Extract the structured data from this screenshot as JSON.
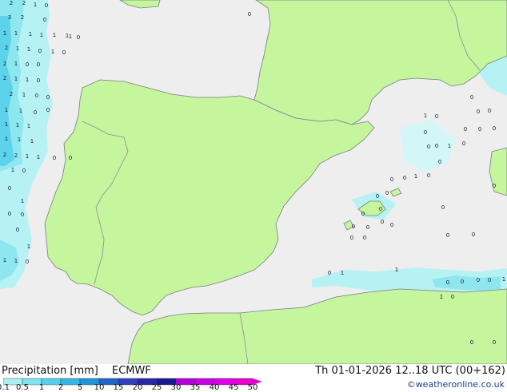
{
  "map": {
    "colors": {
      "land": "#c5f59c",
      "sea": "#eeeeee",
      "border": "#8c9095",
      "coast": "#7a7f84"
    },
    "precip_labels": [
      {
        "t": "2",
        "c": "#1a1a3a"
      },
      {
        "t": "2",
        "c": "#1a1a3a"
      },
      {
        "t": "1",
        "c": "#1a1a3a"
      },
      {
        "t": "0",
        "c": "#1a1a3a"
      },
      {
        "t": "3",
        "c": "#1a1a3a"
      },
      {
        "t": "2",
        "c": "#1a1a3a"
      },
      {
        "t": "0",
        "c": "#1a1a3a"
      },
      {
        "t": "1",
        "c": "#1a1a3a"
      },
      {
        "t": "1",
        "c": "#1a1a3a"
      },
      {
        "t": "1",
        "c": "#1a1a3a"
      },
      {
        "t": "1",
        "c": "#1a1a3a"
      },
      {
        "t": "1",
        "c": "#1a1a3a"
      },
      {
        "t": "1",
        "c": "#1a1a3a"
      },
      {
        "t": "0",
        "c": "#1a1a3a"
      },
      {
        "t": "2",
        "c": "#1a1a3a"
      },
      {
        "t": "1",
        "c": "#1a1a3a"
      },
      {
        "t": "1",
        "c": "#1a1a3a"
      },
      {
        "t": "0",
        "c": "#1a1a3a"
      },
      {
        "t": "1",
        "c": "#1a1a3a"
      },
      {
        "t": "0",
        "c": "#1a1a3a"
      },
      {
        "t": "2",
        "c": "#1a1a3a"
      },
      {
        "t": "1",
        "c": "#1a1a3a"
      },
      {
        "t": "0",
        "c": "#1a1a3a"
      },
      {
        "t": "0",
        "c": "#1a1a3a"
      },
      {
        "t": "2",
        "c": "#1a1a3a"
      },
      {
        "t": "1",
        "c": "#1a1a3a"
      },
      {
        "t": "1",
        "c": "#1a1a3a"
      },
      {
        "t": "0",
        "c": "#1a1a3a"
      },
      {
        "t": "2",
        "c": "#1a1a3a"
      },
      {
        "t": "1",
        "c": "#1a1a3a"
      },
      {
        "t": "0",
        "c": "#1a1a3a"
      },
      {
        "t": "0",
        "c": "#1a1a3a"
      },
      {
        "t": "1",
        "c": "#1a1a3a"
      },
      {
        "t": "1",
        "c": "#1a1a3a"
      },
      {
        "t": "0",
        "c": "#1a1a3a"
      },
      {
        "t": "1",
        "c": "#1a1a3a"
      },
      {
        "t": "1",
        "c": "#1a1a3a"
      },
      {
        "t": "1",
        "c": "#1a1a3a"
      },
      {
        "t": "1",
        "c": "#1a1a3a"
      },
      {
        "t": "1",
        "c": "#1a1a3a"
      },
      {
        "t": "1",
        "c": "#1a1a3a"
      },
      {
        "t": "2",
        "c": "#1a1a3a"
      },
      {
        "t": "2",
        "c": "#1a1a3a"
      },
      {
        "t": "1",
        "c": "#1a1a3a"
      },
      {
        "t": "1",
        "c": "#1a1a3a"
      },
      {
        "t": "0",
        "c": "#1a1a3a"
      },
      {
        "t": "1",
        "c": "#1a1a3a"
      },
      {
        "t": "0",
        "c": "#1a1a3a"
      },
      {
        "t": "0",
        "c": "#1a1a3a"
      },
      {
        "t": "1",
        "c": "#1a1a3a"
      },
      {
        "t": "0",
        "c": "#1a1a3a"
      },
      {
        "t": "0",
        "c": "#1a1a3a"
      },
      {
        "t": "0",
        "c": "#1a1a3a"
      },
      {
        "t": "1",
        "c": "#1a1a3a"
      },
      {
        "t": "1",
        "c": "#1a1a3a"
      },
      {
        "t": "1",
        "c": "#1a1a3a"
      },
      {
        "t": "0",
        "c": "#1a1a3a"
      },
      {
        "t": "1",
        "c": "#1a1a3a"
      },
      {
        "t": "0",
        "c": "#1a1a3a"
      },
      {
        "t": "0",
        "c": "#1a1a3a"
      },
      {
        "t": "0",
        "c": "#1a1a3a"
      },
      {
        "t": "1",
        "c": "#1a1a3a"
      },
      {
        "t": "0",
        "c": "#1a1a3a"
      },
      {
        "t": "0",
        "c": "#1a1a3a"
      },
      {
        "t": "0",
        "c": "#1a1a3a"
      },
      {
        "t": "0",
        "c": "#1a1a3a"
      },
      {
        "t": "0",
        "c": "#1a1a3a"
      },
      {
        "t": "0",
        "c": "#1a1a3a"
      },
      {
        "t": "0",
        "c": "#1a1a3a"
      },
      {
        "t": "1",
        "c": "#1a1a3a"
      },
      {
        "t": "0",
        "c": "#1a1a3a"
      },
      {
        "t": "0",
        "c": "#1a1a3a"
      },
      {
        "t": "0",
        "c": "#1a1a3a"
      },
      {
        "t": "0",
        "c": "#1a1a3a"
      },
      {
        "t": "0",
        "c": "#1a1a3a"
      },
      {
        "t": "0",
        "c": "#1a1a3a"
      },
      {
        "t": "0",
        "c": "#1a1a3a"
      },
      {
        "t": "1",
        "c": "#1a1a3a"
      },
      {
        "t": "0",
        "c": "#1a1a3a"
      },
      {
        "t": "0",
        "c": "#1a1a3a"
      },
      {
        "t": "0",
        "c": "#1a1a3a"
      },
      {
        "t": "0",
        "c": "#1a1a3a"
      },
      {
        "t": "0",
        "c": "#1a1a3a"
      },
      {
        "t": "0",
        "c": "#1a1a3a"
      },
      {
        "t": "0",
        "c": "#1a1a3a"
      },
      {
        "t": "0",
        "c": "#1a1a3a"
      },
      {
        "t": "0",
        "c": "#1a1a3a"
      },
      {
        "t": "0",
        "c": "#1a1a3a"
      },
      {
        "t": "0",
        "c": "#1a1a3a"
      },
      {
        "t": "0",
        "c": "#1a1a3a"
      },
      {
        "t": "0",
        "c": "#1a1a3a"
      },
      {
        "t": "0",
        "c": "#1a1a3a"
      },
      {
        "t": "0",
        "c": "#1a1a3a"
      },
      {
        "t": "0",
        "c": "#1a1a3a"
      },
      {
        "t": "1",
        "c": "#1a1a3a"
      },
      {
        "t": "1",
        "c": "#1a1a3a"
      },
      {
        "t": "0",
        "c": "#1a1a3a"
      },
      {
        "t": "0",
        "c": "#1a1a3a"
      },
      {
        "t": "1",
        "c": "#1a1a3a"
      },
      {
        "t": "0",
        "c": "#1a1a3a"
      },
      {
        "t": "0",
        "c": "#1a1a3a"
      },
      {
        "t": "0",
        "c": "#1a1a3a"
      },
      {
        "t": "1",
        "c": "#1a1a3a"
      },
      {
        "t": "0",
        "c": "#1a1a3a"
      },
      {
        "t": "0",
        "c": "#1a1a3a"
      }
    ]
  },
  "footer": {
    "title": "Precipitation [mm]",
    "model": "ECMWF",
    "datetime": "Th 01-01-2026 12..18 UTC (00+162)",
    "credit": "©weatheronline.co.uk",
    "scale": {
      "ticks": [
        "0.1",
        "0.5",
        "1",
        "2",
        "5",
        "10",
        "15",
        "20",
        "25",
        "30",
        "35",
        "40",
        "45",
        "50"
      ],
      "colors": [
        "#a8f0f4",
        "#7ce3ef",
        "#55d0ea",
        "#33b8e4",
        "#1d95d8",
        "#1f66c8",
        "#2f3fbd",
        "#2828a6",
        "#1a1a90",
        "#b400d8",
        "#c900e6",
        "#dc00ec",
        "#e600d2"
      ]
    }
  }
}
